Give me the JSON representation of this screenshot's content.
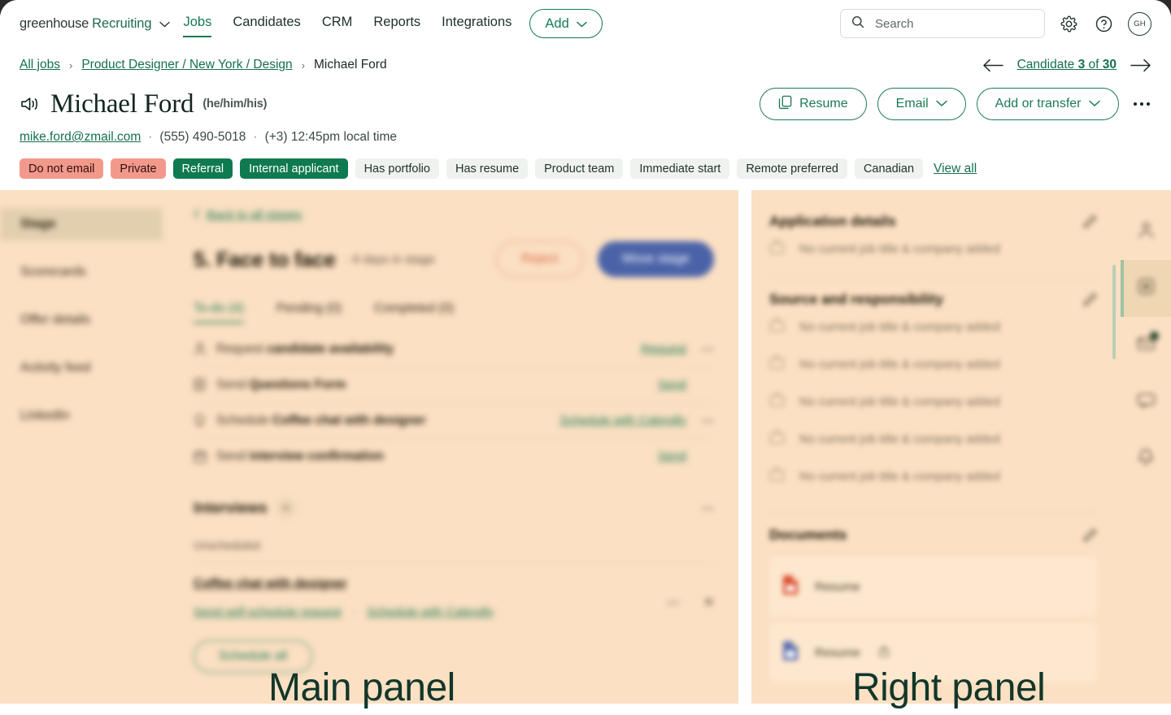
{
  "topnav": {
    "brand_primary": "greenhouse",
    "brand_secondary": "Recruiting",
    "links": [
      {
        "label": "Jobs",
        "active": true
      },
      {
        "label": "Candidates",
        "active": false
      },
      {
        "label": "CRM",
        "active": false
      },
      {
        "label": "Reports",
        "active": false
      },
      {
        "label": "Integrations",
        "active": false
      }
    ],
    "add_label": "Add",
    "search_placeholder": "Search",
    "gear_icon": "gear-icon",
    "help_icon": "question-circle-icon",
    "avatar_initials": "GH"
  },
  "breadcrumb": {
    "items": [
      {
        "label": "All jobs",
        "link": true
      },
      {
        "label": "Product Designer / New York / Design",
        "link": true
      },
      {
        "label": "Michael Ford",
        "link": false
      }
    ],
    "separator": "›"
  },
  "pager": {
    "prev_icon": "arrow-left-icon",
    "next_icon": "arrow-right-icon",
    "prefix": "Candidate ",
    "current": "3",
    "middle": " of ",
    "total": "30"
  },
  "candidate": {
    "speaker_icon": "speaker-pronounce-icon",
    "name": "Michael Ford",
    "pronouns": "(he/him/his)",
    "email": "mike.ford@zmail.com",
    "phone": "(555) 490-5018",
    "local_time": "(+3) 12:45pm local time",
    "dot": "·",
    "actions": {
      "resume": "Resume",
      "email": "Email",
      "add_or_transfer": "Add or transfer",
      "more_icon": "ellipsis-icon"
    }
  },
  "tags": {
    "items": [
      {
        "label": "Do not email",
        "style": "red"
      },
      {
        "label": "Private",
        "style": "red"
      },
      {
        "label": "Referral",
        "style": "green"
      },
      {
        "label": "Internal applicant",
        "style": "green"
      },
      {
        "label": "Has portfolio",
        "style": "grey"
      },
      {
        "label": "Has resume",
        "style": "grey"
      },
      {
        "label": "Product team",
        "style": "grey"
      },
      {
        "label": "Immediate start",
        "style": "grey"
      },
      {
        "label": "Remote preferred",
        "style": "grey"
      },
      {
        "label": "Canadian",
        "style": "grey"
      }
    ],
    "view_all": "View all"
  },
  "stage_nav": {
    "items": [
      {
        "label": "Stage",
        "active": true
      },
      {
        "label": "Scorecards",
        "active": false
      },
      {
        "label": "Offer details",
        "active": false
      },
      {
        "label": "Activity feed",
        "active": false
      },
      {
        "label": "LinkedIn",
        "active": false
      }
    ]
  },
  "main_panel": {
    "back_link": "Back to all stages",
    "stage_title": "5. Face to face",
    "stage_subtitle": "· 6 days in stage",
    "reject_button": "Reject",
    "move_stage_button": "Move stage",
    "tabs": [
      {
        "label": "To-do (4)",
        "active": true
      },
      {
        "label": "Pending (0)",
        "active": false
      },
      {
        "label": "Completed (0)",
        "active": false
      }
    ],
    "todos": [
      {
        "icon": "person-icon",
        "prefix": "Request ",
        "bold": "candidate availability",
        "action": "Request",
        "more": "—"
      },
      {
        "icon": "form-icon",
        "prefix": "Send ",
        "bold": "Questions Form",
        "action": "Send",
        "more": ""
      },
      {
        "icon": "bulb-icon",
        "prefix": "Schedule ",
        "bold": "Coffee chat with designer",
        "action": "Schedule with Calendly",
        "more": "—"
      },
      {
        "icon": "calendar-icon",
        "prefix": "Send ",
        "bold": "interview confirmation",
        "action": "Send",
        "more": ""
      }
    ],
    "interviews": {
      "title": "Interviews",
      "add_icon": "plus-icon",
      "more": "—",
      "unscheduled_label": "Unscheduled",
      "item_title": "Coffee chat with designer",
      "link_self_schedule": "Send self-schedule request",
      "link_separator": "·",
      "link_calendly": "Schedule with Calendly",
      "minus": "—",
      "close": "✕",
      "schedule_all": "Schedule all"
    }
  },
  "right_panel": {
    "sections": [
      {
        "title": "Application details",
        "pencil_icon": "pencil-icon",
        "rows": [
          "No current job title & company added"
        ]
      },
      {
        "title": "Source and responsibility",
        "pencil_icon": "pencil-icon",
        "rows": [
          "No current job title & company added",
          "No current job title & company added",
          "No current job title & company added",
          "No current job title & company added",
          "No current job title & company added"
        ]
      }
    ],
    "documents": {
      "title": "Documents",
      "pencil_icon": "pencil-icon",
      "items": [
        {
          "label": "Resume",
          "color": "#d94f2e",
          "locked": false
        },
        {
          "label": "Resume",
          "color": "#5c6fb0",
          "locked": true
        }
      ]
    }
  },
  "rail": {
    "items": [
      {
        "icon": "person-icon",
        "active": false,
        "badge": false
      },
      {
        "icon": "briefcase-details-icon",
        "active": true,
        "badge": false
      },
      {
        "icon": "email-icon",
        "active": false,
        "badge": true
      },
      {
        "icon": "chat-icon",
        "active": false,
        "badge": false
      },
      {
        "icon": "notification-bell-icon",
        "active": false,
        "badge": false
      }
    ]
  },
  "overlays": {
    "main_panel_label": "Main panel",
    "right_panel_label": "Right panel"
  },
  "colors": {
    "brand_green": "#137a52",
    "panel_bg": "#fbe0c3",
    "tag_red": "#f2998c",
    "tag_green": "#0f7a4f",
    "move_stage_blue": "#4a63a8",
    "reject_red": "#d9603f",
    "overlay_text": "#12372a"
  }
}
